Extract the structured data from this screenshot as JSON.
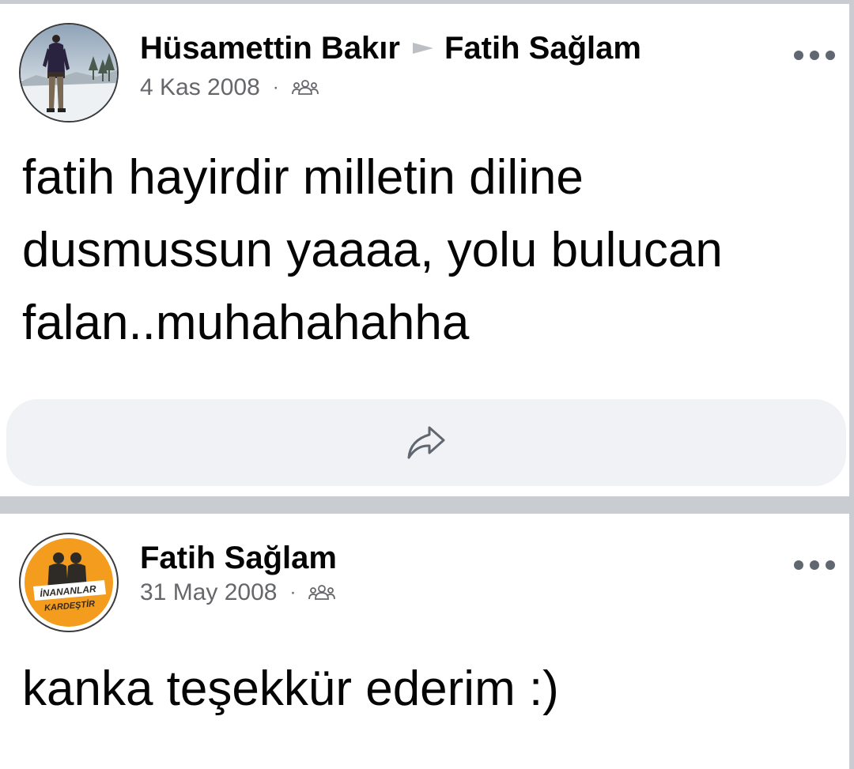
{
  "posts": [
    {
      "author": "Hüsamettin Bakır",
      "target": "Fatih Sağlam",
      "date": "4 Kas 2008",
      "separator": "·",
      "audience_icon": "friends-icon",
      "body": "fatih hayirdir milletin diline dusmussun yaaaa, yolu bulucan falan..muhahahahha",
      "share_icon": "share-icon",
      "more_icon": "more-options-icon"
    },
    {
      "author": "Fatih Sağlam",
      "date": "31 May 2008",
      "separator": "·",
      "audience_icon": "friends-icon",
      "body": "kanka teşekkür ederim :)",
      "more_icon": "more-options-icon",
      "avatar_text": [
        "İNANANLAR",
        "KARDEŞTİR"
      ]
    }
  ],
  "colors": {
    "background": "#ffffff",
    "divider": "#c9ccd1",
    "meta_text": "#65676b",
    "share_bar": "#f0f2f5",
    "badge_orange": "#f39c1e"
  }
}
